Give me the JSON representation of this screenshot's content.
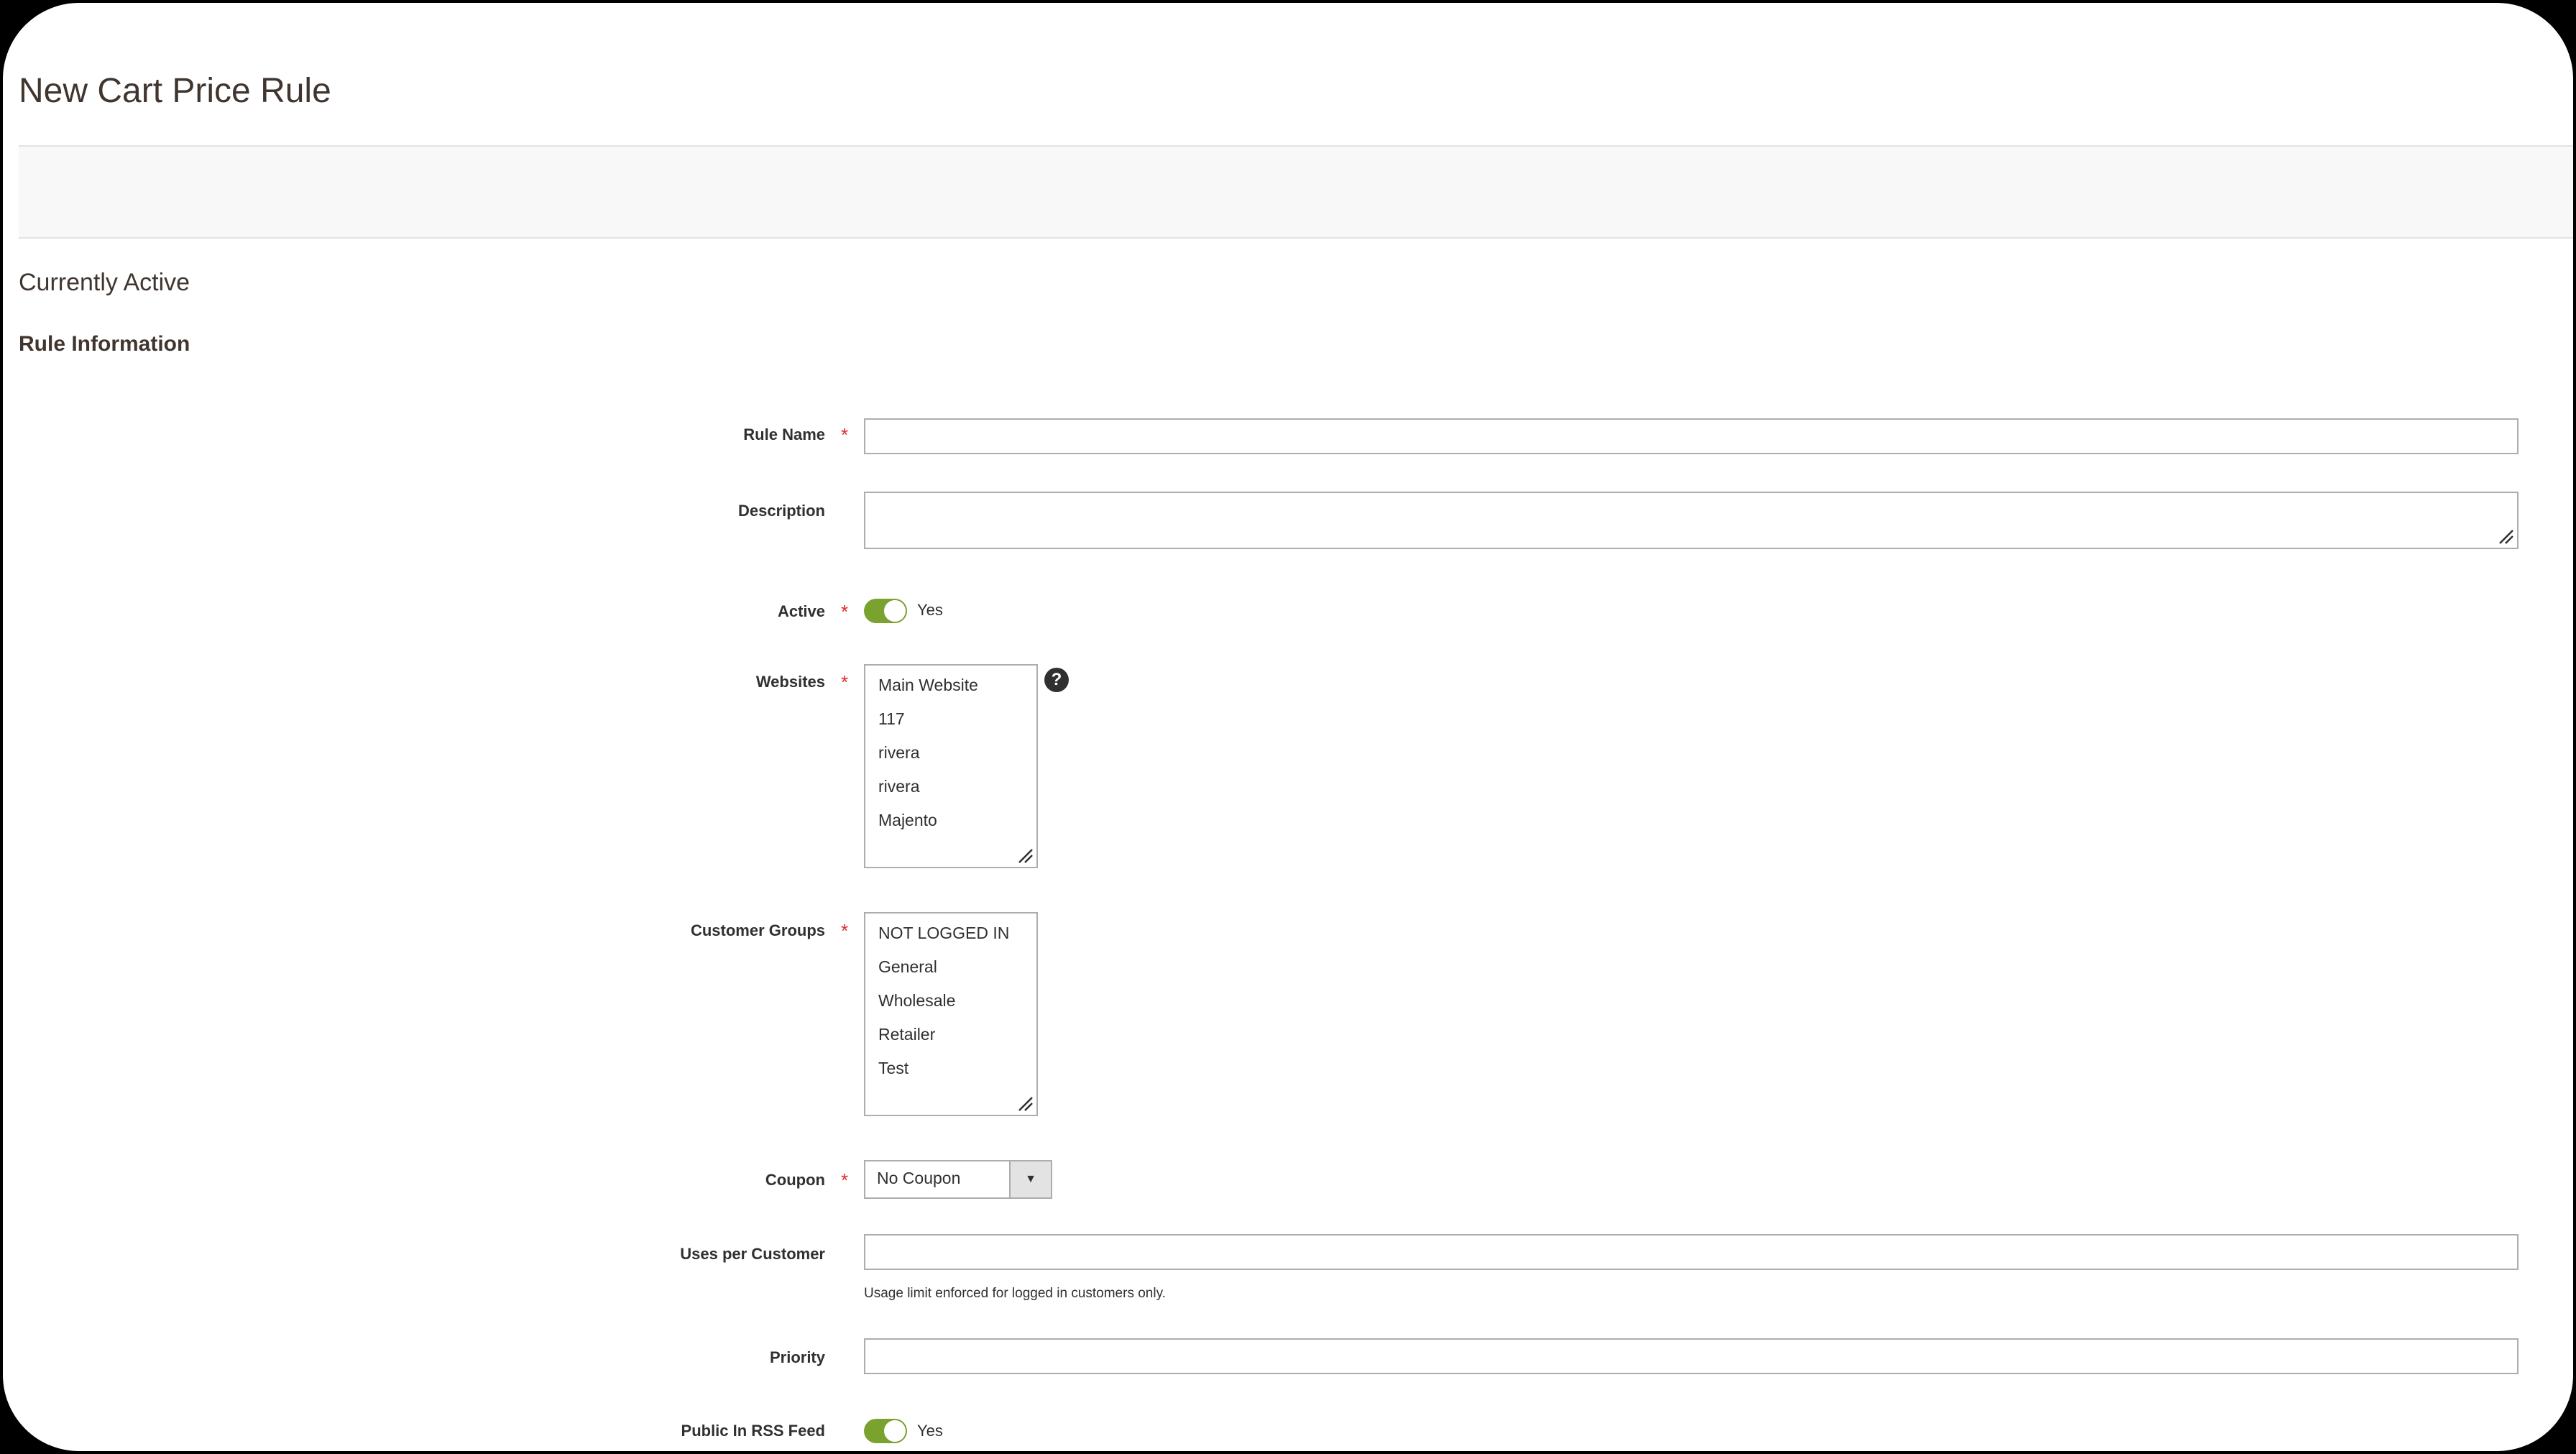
{
  "page": {
    "title": "New Cart Price Rule"
  },
  "status": "Currently Active",
  "section": {
    "title": "Rule Information"
  },
  "fields": {
    "rule_name": {
      "label": "Rule Name",
      "value": ""
    },
    "description": {
      "label": "Description",
      "value": ""
    },
    "active": {
      "label": "Active",
      "state": "Yes"
    },
    "websites": {
      "label": "Websites",
      "options": [
        "Main Website",
        "117",
        "rivera",
        "rivera",
        "Majento"
      ]
    },
    "customer_groups": {
      "label": "Customer Groups",
      "options": [
        "NOT LOGGED IN",
        "General",
        "Wholesale",
        "Retailer",
        "Test"
      ]
    },
    "coupon": {
      "label": "Coupon",
      "value": "No Coupon"
    },
    "uses_per_customer": {
      "label": "Uses per Customer",
      "value": "",
      "note": "Usage limit enforced for logged in customers only."
    },
    "priority": {
      "label": "Priority",
      "value": ""
    },
    "public_rss": {
      "label": "Public In RSS Feed",
      "state": "Yes"
    }
  },
  "colors": {
    "toggle_on": "#79a22e",
    "required": "#e22626",
    "border": "#adadad"
  }
}
